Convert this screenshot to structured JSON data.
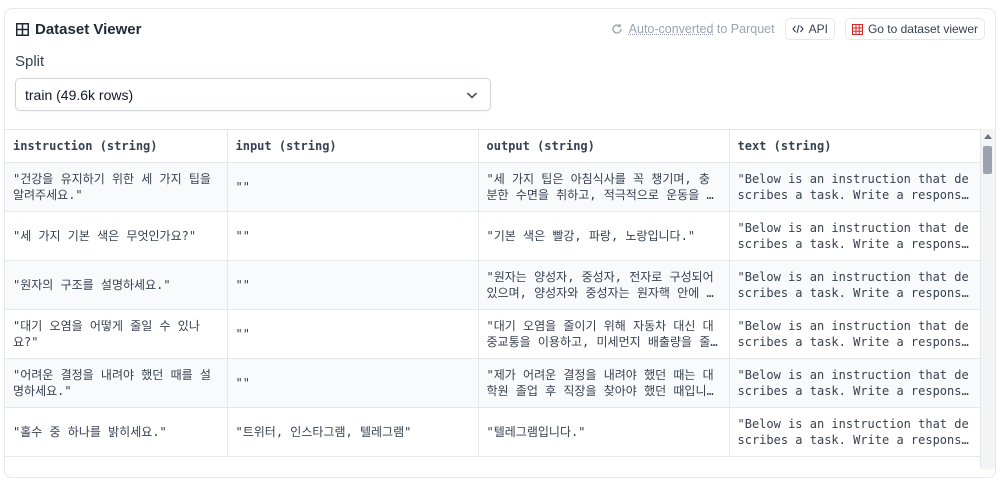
{
  "header": {
    "title": "Dataset Viewer",
    "auto_converted_link": "Auto-converted",
    "auto_converted_rest": " to Parquet",
    "api_label": "API",
    "go_to_viewer_label": "Go to dataset viewer"
  },
  "split": {
    "label": "Split",
    "selected": "train (49.6k rows)"
  },
  "table": {
    "columns": [
      {
        "name": "instruction (string)"
      },
      {
        "name": "input (string)"
      },
      {
        "name": "output (string)"
      },
      {
        "name": "text (string)"
      }
    ],
    "rows": [
      [
        "\"건강을 유지하기 위한 세 가지 팁을 알려주세요.\"",
        "\"\"",
        "\"세 가지 팁은 아침식사를 꼭 챙기며, 충분한 수면을 취하고, 적극적으로 운동을 하는 것입니다.\"",
        "\"Below is an instruction that describes a task. Write a response that appropriately completes the request.\""
      ],
      [
        "\"세 가지 기본 색은 무엇인가요?\"",
        "\"\"",
        "\"기본 색은 빨강, 파랑, 노랑입니다.\"",
        "\"Below is an instruction that describes a task. Write a response that appropriately completes the request.\""
      ],
      [
        "\"원자의 구조를 설명하세요.\"",
        "\"\"",
        "\"원자는 양성자, 중성자, 전자로 구성되어 있으며, 양성자와 중성자는 원자핵 안에 있습니다.\"",
        "\"Below is an instruction that describes a task. Write a response that appropriately completes the request.\""
      ],
      [
        "\"대기 오염을 어떻게 줄일 수 있나요?\"",
        "\"\"",
        "\"대기 오염을 줄이기 위해 자동차 대신 대중교통을 이용하고, 미세먼지 배출량을 줄여야 합니다.\"",
        "\"Below is an instruction that describes a task. Write a response that appropriately completes the request.\""
      ],
      [
        "\"어려운 결정을 내려야 했던 때를 설명하세요.\"",
        "\"\"",
        "\"제가 어려운 결정을 내려야 했던 때는 대학원 졸업 후 직장을 찾아야 했던 때입니다.\"",
        "\"Below is an instruction that describes a task. Write a response that appropriately completes the request.\""
      ],
      [
        "\"홀수 중 하나를 밝히세요.\"",
        "\"트위터, 인스타그램, 텔레그램\"",
        "\"텔레그램입니다.\"",
        "\"Below is an instruction that describes a task. Write a response that appropriately completes the request.\""
      ]
    ]
  }
}
